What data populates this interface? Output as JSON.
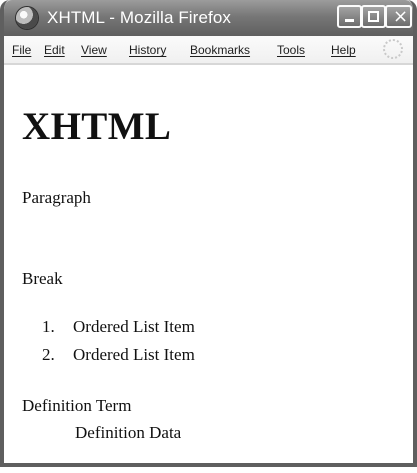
{
  "window": {
    "title": "XHTML - Mozilla Firefox",
    "controls": {
      "minimize_icon": "minimize-icon",
      "maximize_icon": "maximize-icon",
      "close_symbol": "×"
    }
  },
  "menu": {
    "items": [
      {
        "label": "File"
      },
      {
        "label": "Edit"
      },
      {
        "label": "View"
      },
      {
        "label": "History"
      },
      {
        "label": "Bookmarks"
      },
      {
        "label": "Tools"
      },
      {
        "label": "Help"
      }
    ]
  },
  "page": {
    "heading": "XHTML",
    "paragraph": "Paragraph",
    "break_text": "Break",
    "ordered_list": [
      {
        "number": "1.",
        "text": "Ordered List Item"
      },
      {
        "number": "2.",
        "text": "Ordered List Item"
      }
    ],
    "definition_term": "Definition Term",
    "definition_data": "Definition Data"
  },
  "colors": {
    "titlebar": "#6f6f6f",
    "window_border": "#5f5f5f",
    "content_background": "#ffffff",
    "text": "#111111"
  },
  "icons": {
    "app": "firefox-icon",
    "loading": "throbber-icon"
  }
}
